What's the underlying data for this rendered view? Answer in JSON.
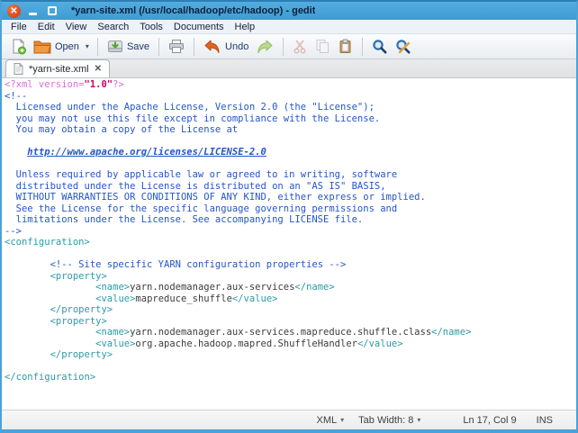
{
  "window": {
    "title": "*yarn-site.xml (/usr/local/hadoop/etc/hadoop) - gedit"
  },
  "icons": {
    "close_x": "✕",
    "dropdown": "▾"
  },
  "menu": {
    "items": [
      "File",
      "Edit",
      "View",
      "Search",
      "Tools",
      "Documents",
      "Help"
    ]
  },
  "toolbar": {
    "open_label": "Open",
    "save_label": "Save",
    "undo_label": "Undo"
  },
  "tab": {
    "label": "*yarn-site.xml"
  },
  "statusbar": {
    "language": "XML",
    "tab_width": "Tab Width: 8",
    "position": "Ln 17, Col 9",
    "mode": "INS"
  },
  "code": {
    "lines": [
      [
        {
          "c": "decl",
          "t": "<?xml version="
        },
        {
          "c": "str",
          "t": "\"1.0\""
        },
        {
          "c": "decl",
          "t": "?>"
        }
      ],
      [
        {
          "c": "comment",
          "t": "<!--"
        }
      ],
      [
        {
          "c": "comment",
          "t": "  Licensed under the Apache License, Version 2.0 (the \"License\");"
        }
      ],
      [
        {
          "c": "comment",
          "t": "  you may not use this file except in compliance with the License."
        }
      ],
      [
        {
          "c": "comment",
          "t": "  You may obtain a copy of the License at"
        }
      ],
      [],
      [
        {
          "c": "comment",
          "t": "    "
        },
        {
          "c": "link",
          "t": "http://www.apache.org/licenses/LICENSE-2.0"
        }
      ],
      [],
      [
        {
          "c": "comment",
          "t": "  Unless required by applicable law or agreed to in writing, software"
        }
      ],
      [
        {
          "c": "comment",
          "t": "  distributed under the License is distributed on an \"AS IS\" BASIS,"
        }
      ],
      [
        {
          "c": "comment",
          "t": "  WITHOUT WARRANTIES OR CONDITIONS OF ANY KIND, either express or implied."
        }
      ],
      [
        {
          "c": "comment",
          "t": "  See the License for the specific language governing permissions and"
        }
      ],
      [
        {
          "c": "comment",
          "t": "  limitations under the License. See accompanying LICENSE file."
        }
      ],
      [
        {
          "c": "comment",
          "t": "-->"
        }
      ],
      [
        {
          "c": "tag",
          "t": "<configuration>"
        }
      ],
      [],
      [
        {
          "c": "text",
          "t": "        "
        },
        {
          "c": "comment",
          "t": "<!-- Site specific YARN configuration properties -->"
        }
      ],
      [
        {
          "c": "text",
          "t": "        "
        },
        {
          "c": "tag",
          "t": "<property>"
        }
      ],
      [
        {
          "c": "text",
          "t": "                "
        },
        {
          "c": "tag",
          "t": "<name>"
        },
        {
          "c": "text",
          "t": "yarn.nodemanager.aux-services"
        },
        {
          "c": "tag",
          "t": "</name>"
        }
      ],
      [
        {
          "c": "text",
          "t": "                "
        },
        {
          "c": "tag",
          "t": "<value>"
        },
        {
          "c": "text",
          "t": "mapreduce_shuffle"
        },
        {
          "c": "tag",
          "t": "</value>"
        }
      ],
      [
        {
          "c": "text",
          "t": "        "
        },
        {
          "c": "tag",
          "t": "</property>"
        }
      ],
      [
        {
          "c": "text",
          "t": "        "
        },
        {
          "c": "tag",
          "t": "<property>"
        }
      ],
      [
        {
          "c": "text",
          "t": "                "
        },
        {
          "c": "tag",
          "t": "<name>"
        },
        {
          "c": "text",
          "t": "yarn.nodemanager.aux-services.mapreduce.shuffle.class"
        },
        {
          "c": "tag",
          "t": "</name>"
        }
      ],
      [
        {
          "c": "text",
          "t": "                "
        },
        {
          "c": "tag",
          "t": "<value>"
        },
        {
          "c": "text",
          "t": "org.apache.hadoop.mapred.ShuffleHandler"
        },
        {
          "c": "tag",
          "t": "</value>"
        }
      ],
      [
        {
          "c": "text",
          "t": "        "
        },
        {
          "c": "tag",
          "t": "</property>"
        }
      ],
      [],
      [
        {
          "c": "tag",
          "t": "</configuration>"
        }
      ]
    ]
  }
}
